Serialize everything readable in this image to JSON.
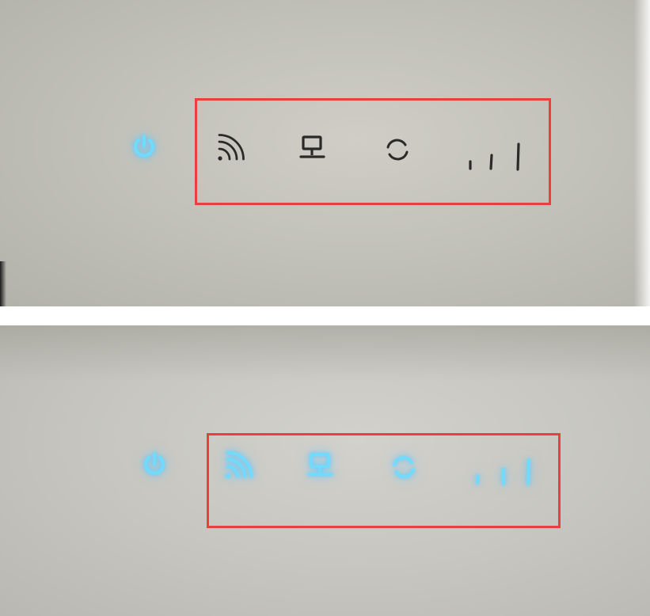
{
  "photos": [
    {
      "state": "off",
      "colors": {
        "power_led": "#6fdcff",
        "inactive_led": "#2a2a28",
        "highlight_box": "#e8403c"
      },
      "indicators": [
        {
          "icon": "power-icon",
          "lit": true
        },
        {
          "icon": "wifi-icon",
          "lit": false
        },
        {
          "icon": "lan-icon",
          "lit": false
        },
        {
          "icon": "sync-icon",
          "lit": false
        },
        {
          "icon": "signal-icon",
          "lit": false
        }
      ]
    },
    {
      "state": "on",
      "colors": {
        "power_led": "#6fdcff",
        "active_led": "#6fdcff",
        "highlight_box": "#e8403c"
      },
      "indicators": [
        {
          "icon": "power-icon",
          "lit": true
        },
        {
          "icon": "wifi-icon",
          "lit": true
        },
        {
          "icon": "lan-icon",
          "lit": true
        },
        {
          "icon": "sync-icon",
          "lit": true
        },
        {
          "icon": "signal-icon",
          "lit": true
        }
      ]
    }
  ]
}
